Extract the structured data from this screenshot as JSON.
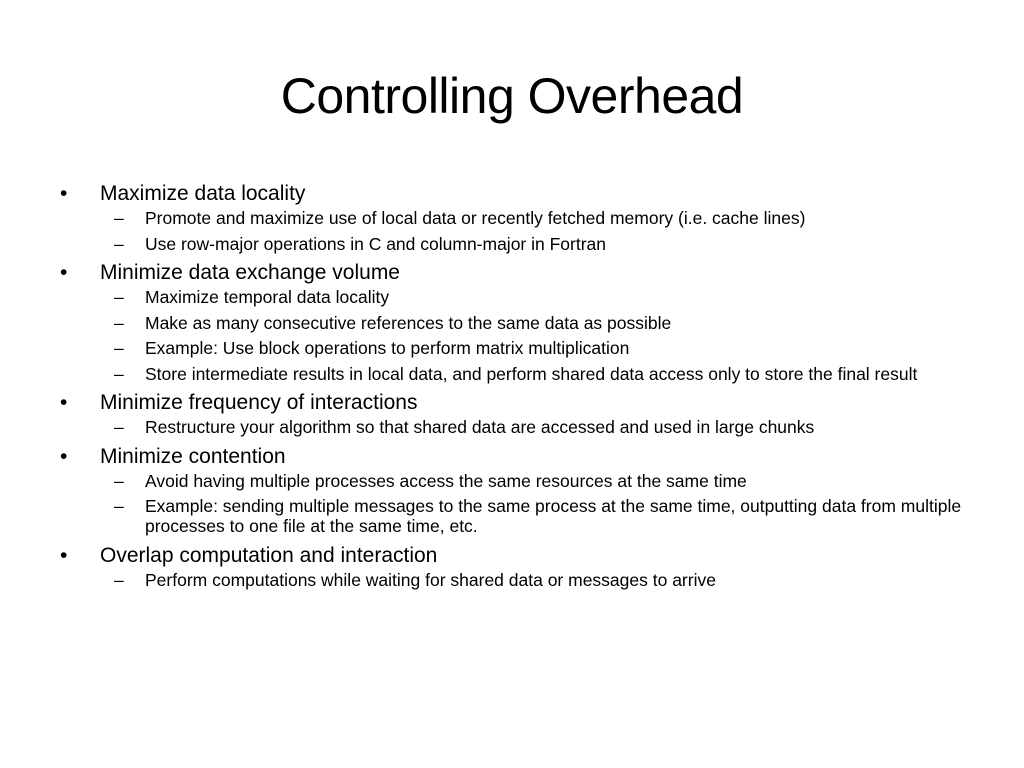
{
  "slide": {
    "title": "Controlling Overhead",
    "bullets": [
      {
        "text": "Maximize data locality",
        "subs": [
          "Promote and maximize use of local data or recently fetched memory (i.e. cache lines)",
          "Use row-major operations in C and column-major in Fortran"
        ]
      },
      {
        "text": "Minimize data exchange volume",
        "subs": [
          "Maximize temporal data locality",
          "Make as many consecutive references to the same data as possible",
          "Example: Use block operations to perform matrix multiplication",
          "Store intermediate results in local data, and perform shared data access only to store the final result"
        ]
      },
      {
        "text": "Minimize frequency of interactions",
        "subs": [
          "Restructure your algorithm so that shared data are accessed and used in large chunks"
        ]
      },
      {
        "text": "Minimize contention",
        "subs": [
          "Avoid having multiple processes access the same resources at the same time",
          "Example: sending multiple messages to the same process at the same time, outputting data from multiple processes to one file at the same time, etc."
        ]
      },
      {
        "text": "Overlap computation and interaction",
        "subs": [
          "Perform computations while waiting for shared data or messages to arrive"
        ]
      }
    ],
    "bullet_glyph": "•",
    "dash_glyph": "–"
  }
}
